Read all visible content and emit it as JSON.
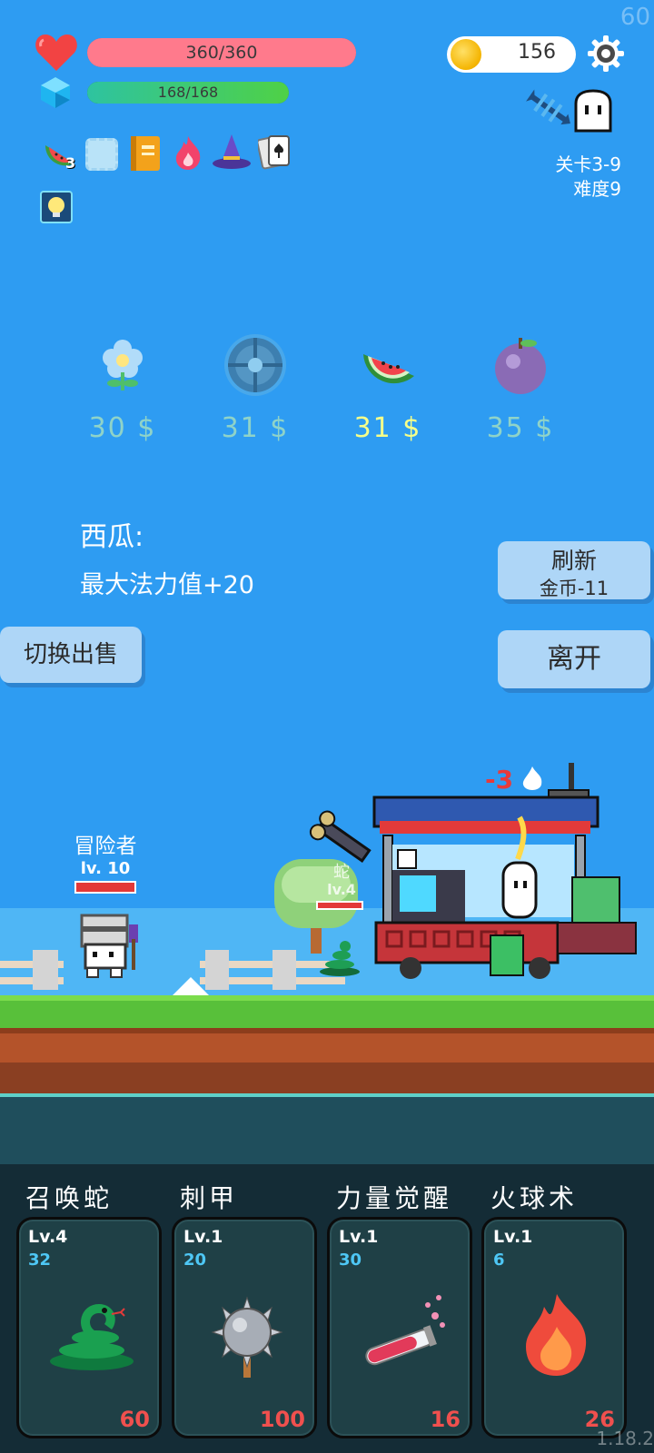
{
  "hud": {
    "fps": "60",
    "hp_text": "360/360",
    "hp_fraction": 1.0,
    "mana_text": "168/168",
    "mana_fraction": 1.0,
    "coins": "156",
    "stage": "关卡3-9",
    "difficulty": "难度9",
    "watermelon_count": "3",
    "icons": [
      "heart-icon",
      "gem-icon",
      "coin-icon",
      "gear-icon",
      "fish-bone-icon",
      "ghost-icon"
    ],
    "items": [
      "watermelon-icon",
      "empty-slot-icon",
      "book-icon",
      "flame-icon",
      "wizard-hat-icon",
      "playing-cards-icon",
      "lightbulb-icon"
    ]
  },
  "shop": {
    "items": [
      {
        "icon": "flower-icon",
        "price": "30 $",
        "selected": false
      },
      {
        "icon": "shield-icon",
        "price": "31 $",
        "selected": false
      },
      {
        "icon": "watermelon-icon",
        "price": "31 $",
        "selected": true
      },
      {
        "icon": "plum-icon",
        "price": "35 $",
        "selected": false
      }
    ],
    "selected_title": "西瓜:",
    "selected_desc": "最大法力值+20",
    "refresh_label": "刷新",
    "refresh_cost": "金币-11",
    "toggle_sell_label": "切换出售",
    "leave_label": "离开"
  },
  "scene": {
    "hero_name": "冒险者",
    "hero_level": "lv. 10",
    "snake_name": "蛇",
    "snake_level": "lv.4",
    "damage_text": "-3"
  },
  "skills": [
    {
      "name": "召唤蛇",
      "level": "Lv.4",
      "value": "32",
      "cost": "60",
      "icon": "snake-icon"
    },
    {
      "name": "刺甲",
      "level": "Lv.1",
      "value": "20",
      "cost": "100",
      "icon": "spiked-ball-icon"
    },
    {
      "name": "力量觉醒",
      "level": "Lv.1",
      "value": "30",
      "cost": "16",
      "icon": "potion-tube-icon"
    },
    {
      "name": "火球术",
      "level": "Lv.1",
      "value": "6",
      "cost": "26",
      "icon": "fire-icon"
    }
  ],
  "version": "1.18.2",
  "colors": {
    "background": "#2e9cf2",
    "hp_bar": "#ff7a8c",
    "mana_bar": "#3ccf6a",
    "price_normal": "#8fd3c8",
    "price_selected": "#f6ff8a",
    "cost_red": "#f0504e",
    "card_bg": "#1f4046"
  }
}
